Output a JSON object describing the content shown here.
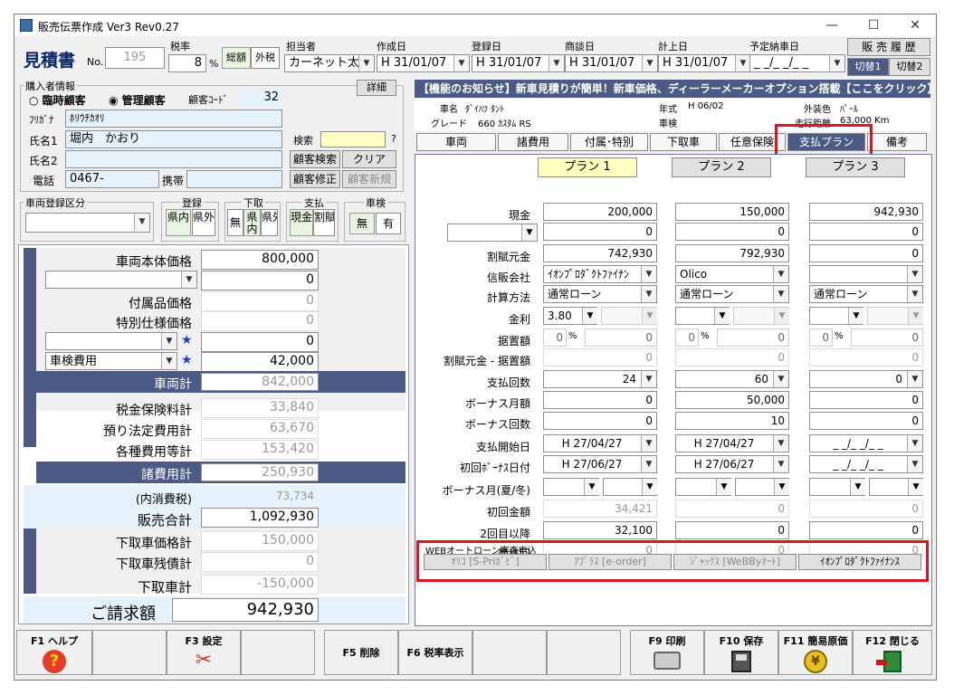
{
  "window": {
    "title": "販売伝票作成 Ver3 Rev0.27",
    "min": "—",
    "max": "☐",
    "close": "✕"
  },
  "header": {
    "doc_title": "見積書",
    "no_label": "No.",
    "no_value": "195",
    "tax_label": "税率",
    "tax_value": "8",
    "tax_unit": "%",
    "total_label": "総額",
    "ex_tax_label": "外税",
    "staff_label": "担当者",
    "staff_value": "カーネット太",
    "created_label": "作成日",
    "created_value": "H 31/01/07",
    "registered_label": "登録日",
    "registered_value": "H 31/01/07",
    "negotiation_label": "商談日",
    "negotiation_value": "H 31/01/07",
    "booking_label": "計上日",
    "booking_value": "H 31/01/07",
    "delivery_label": "予定納車日",
    "delivery_value": "_ _/_ _/_ _",
    "history_button": "販 売 履 歴",
    "switch1": "切替1",
    "switch2": "切替2"
  },
  "buyer": {
    "group_label": "購入者情報",
    "radio_temp": "臨時顧客",
    "radio_managed": "管理顧客",
    "code_label": "顧客ｺｰﾄﾞ",
    "code_value": "32",
    "detail_button": "詳細",
    "furigana_label": "ﾌﾘｶﾞﾅ",
    "furigana_value": "ﾎﾘｳﾁｶｵﾘ",
    "name1_label": "氏名1",
    "name1_value": "堀内　かおり",
    "search_label": "検索",
    "search_q": "?",
    "name2_label": "氏名2",
    "customer_search": "顧客検索",
    "clear": "クリア",
    "phone_label": "電話",
    "phone_value": "0467-",
    "mobile_label": "携帯",
    "customer_edit": "顧客修正",
    "customer_new": "顧客新規"
  },
  "registration": {
    "group_label": "車両登録区分",
    "reg_label": "登録",
    "reg_in": "県内",
    "reg_out": "県外",
    "trade_label": "下取",
    "trade_none": "無",
    "trade_in": "県内",
    "trade_out": "県外",
    "pay_label": "支払",
    "pay_cash": "現金",
    "pay_loan": "割賦",
    "inspection_label": "車検",
    "insp_none": "無",
    "insp_yes": "有"
  },
  "pricing": {
    "vehicle_price_label": "車両本体価格",
    "vehicle_price": "800,000",
    "discount_value": "0",
    "accessory_label": "付属品価格",
    "accessory": "0",
    "special_label": "特別仕様価格",
    "special": "0",
    "extra_value": "0",
    "extra2_name": "車検費用",
    "extra2_value": "42,000",
    "star": "★",
    "vehicle_total_label": "車両計",
    "vehicle_total": "842,000",
    "tax_ins_label": "税金保険料計",
    "tax_ins": "33,840",
    "deposit_label": "預り法定費用計",
    "deposit": "63,670",
    "misc_label": "各種費用等計",
    "misc": "153,420",
    "expense_total_label": "諸費用計",
    "expense_total": "250,930",
    "consumption_label": "(内消費税)",
    "consumption": "73,734",
    "sales_total_label": "販売合計",
    "sales_total": "1,092,930",
    "trade_price_label": "下取車価格計",
    "trade_price": "150,000",
    "trade_balance_label": "下取車残債計",
    "trade_balance": "0",
    "trade_total_label": "下取車計",
    "trade_total": "-150,000",
    "invoice_label": "ご請求額",
    "invoice": "942,930"
  },
  "notice": {
    "text": "【機能のお知らせ】新車見積りが簡単！新車価格、ディーラーメーカーオプション搭載【ここをクリック】"
  },
  "car": {
    "name_label": "車名",
    "name_value": "ﾀﾞｲﾊﾂ ﾀﾝﾄ",
    "year_label": "年式",
    "year_value": "H 06/02",
    "color_label": "外装色",
    "color_value": "ﾊﾟｰﾙ",
    "grade_label": "グレード",
    "grade_value": "660 ｶｽﾀﾑ RS",
    "inspection_label": "車検",
    "mileage_label": "走行距離",
    "mileage_value": "63,000 Km"
  },
  "tabs": [
    "車両",
    "諸費用",
    "付属･特別",
    "下取車",
    "任意保険",
    "支払プラン",
    "備考"
  ],
  "plans": {
    "headers": [
      "プラン 1",
      "プラン 2",
      "プラン 3"
    ],
    "row_labels": [
      "現金",
      "",
      "割賦元金",
      "信販会社",
      "計算方法",
      "金利",
      "据置額",
      "割賦元金 - 据置額",
      "支払回数",
      "ボーナス月額",
      "ボーナス回数",
      "支払開始日",
      "初回ﾎﾞｰﾅｽ日付",
      "ボーナス月(夏/冬)",
      "初回金額",
      "2回目以降",
      "最終回"
    ],
    "p1": {
      "cash": "200,000",
      "sub": "0",
      "principal": "742,930",
      "company": "ｲｵﾝﾌﾟﾛﾀﾞｸﾄﾌｧｲﾅﾝ",
      "method": "通常ローン",
      "rate": "3.80",
      "defer_pct": "0",
      "defer_amt": "0",
      "remain": "0",
      "count": "24",
      "bonus_amt": "0",
      "bonus_count": "0",
      "start": "H 27/04/27",
      "bonus_date": "H 27/06/27",
      "first": "34,421",
      "second": "32,100",
      "last": "0"
    },
    "p2": {
      "cash": "150,000",
      "sub": "0",
      "principal": "792,930",
      "company": "Olico",
      "method": "通常ローン",
      "rate": "",
      "defer_pct": "0",
      "defer_amt": "0",
      "remain": "0",
      "count": "60",
      "bonus_amt": "50,000",
      "bonus_count": "10",
      "start": "H 27/04/27",
      "bonus_date": "H 27/06/27",
      "first": "0",
      "second": "0",
      "last": "0"
    },
    "p3": {
      "cash": "942,930",
      "sub": "0",
      "principal": "0",
      "company": "",
      "method": "通常ローン",
      "rate": "",
      "defer_pct": "0",
      "defer_amt": "0",
      "remain": "0",
      "count": "0",
      "bonus_amt": "0",
      "bonus_count": "0",
      "start": "_ _/_ _/_ _",
      "bonus_date": "_ _/_ _/_ _",
      "first": "0",
      "second": "0",
      "last": "0"
    },
    "pct": "%"
  },
  "web_loan": {
    "label": "WEBオートローン審査申込",
    "buttons": [
      "ｵﾘｺ [S-Priｶﾞﾋﾞ]",
      "ｱﾌﾟﾗｽ [e-order]",
      "ｼﾞｬｯｸｽ [WeBByｵｰﾄ]",
      "ｲｵﾝﾌﾟﾛﾀﾞｸﾄﾌｧｲﾅﾝｽ"
    ]
  },
  "fkeys": {
    "f1": "F1 ヘルプ",
    "f3": "F3 設定",
    "f5": "F5 削除",
    "f6": "F6 税率表示",
    "f9": "F9 印刷",
    "f10": "F10 保存",
    "f11": "F11 簡易原価",
    "f12": "F12 閉じる"
  },
  "icons": {
    "help": "?",
    "settings": "✂",
    "yen": "¥"
  }
}
